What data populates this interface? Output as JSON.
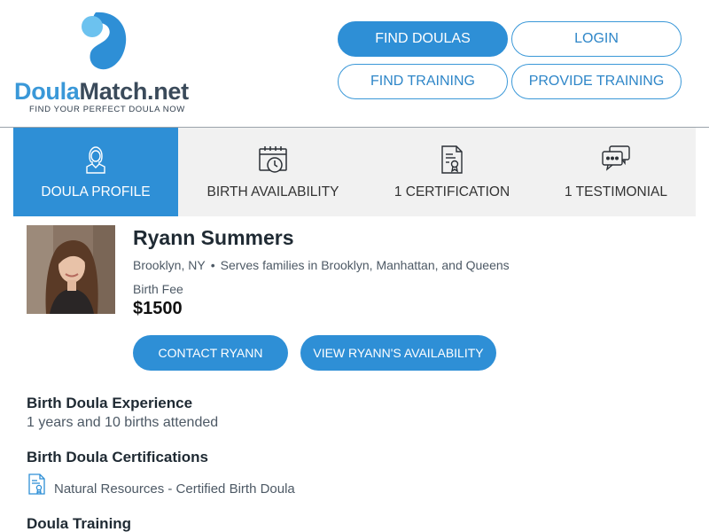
{
  "brand": {
    "name_part1": "Doula",
    "name_part2": "Match.net",
    "tagline": "FIND YOUR PERFECT DOULA NOW",
    "primary_color": "#2e8fd6",
    "dark_color": "#3a4a5a"
  },
  "nav": {
    "find_doulas": "FIND DOULAS",
    "login": "LOGIN",
    "find_training": "FIND TRAINING",
    "provide_training": "PROVIDE TRAINING"
  },
  "tabs": [
    {
      "label": "DOULA PROFILE",
      "icon": "person-icon",
      "active": true
    },
    {
      "label": "BIRTH AVAILABILITY",
      "icon": "calendar-clock-icon",
      "active": false
    },
    {
      "label": "1 CERTIFICATION",
      "icon": "certificate-icon",
      "active": false
    },
    {
      "label": "1 TESTIMONIAL",
      "icon": "chat-bubbles-icon",
      "active": false
    }
  ],
  "profile": {
    "name": "Ryann Summers",
    "location": "Brooklyn, NY",
    "separator": "•",
    "serves": "Serves families in Brooklyn, Manhattan, and Queens",
    "fee_label": "Birth Fee",
    "fee_value": "$1500",
    "photo_icon": "profile-photo"
  },
  "actions": {
    "contact": "CONTACT RYANN",
    "availability": "VIEW RYANN'S AVAILABILITY"
  },
  "sections": {
    "experience_title": "Birth Doula Experience",
    "experience_body": "1 years and 10 births attended",
    "certifications_title": "Birth Doula Certifications",
    "certification_item": "Natural Resources - Certified Birth Doula",
    "certification_icon": "certificate-icon",
    "training_title": "Doula Training"
  }
}
